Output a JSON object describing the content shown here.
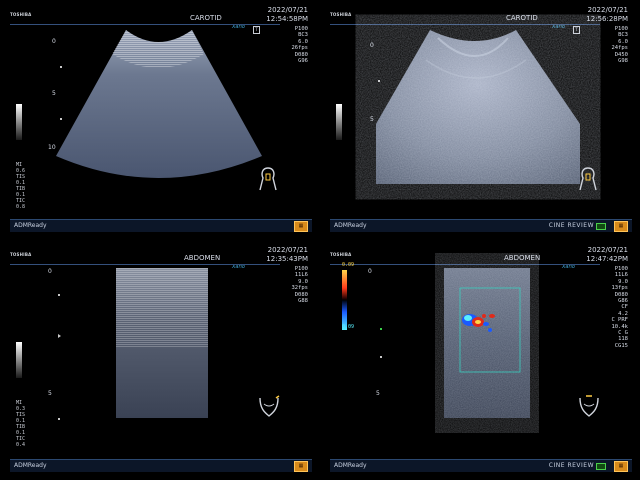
{
  "brand": "TOSHIBA",
  "logo": "Xario",
  "panels": [
    {
      "preset": "CAROTID",
      "date": "2022/07/21",
      "time": "12:54:58PM",
      "params": [
        "P100",
        "BC3",
        "6.0",
        "26fps",
        "D080",
        "G96"
      ],
      "depths": [
        "0",
        "5",
        "10"
      ],
      "mi": [
        "MI",
        "0.6",
        "TIS",
        "0.1",
        "TIB",
        "0.1",
        "TIC",
        "0.8"
      ],
      "status": "ADMReady",
      "cine": "",
      "colorscale": []
    },
    {
      "preset": "CAROTID",
      "date": "2022/07/21",
      "time": "12:56:28PM",
      "params": [
        "P100",
        "BC3",
        "6.0",
        "24fps",
        "D450",
        "G98"
      ],
      "depths": [
        "0",
        "5"
      ],
      "mi": [],
      "status": "ADMReady",
      "cine": "CINE REVIEW",
      "colorscale": []
    },
    {
      "preset": "ABDOMEN",
      "date": "2022/07/21",
      "time": "12:35:43PM",
      "params": [
        "P100",
        "11L6",
        "9.0",
        "32fps",
        "D080",
        "G88"
      ],
      "depths": [
        "0",
        "5"
      ],
      "mi": [
        "MI",
        "0.3",
        "TIS",
        "0.1",
        "TIB",
        "0.1",
        "TIC",
        "0.4"
      ],
      "status": "ADMReady",
      "cine": "",
      "colorscale": []
    },
    {
      "preset": "ABDOMEN",
      "date": "2022/07/21",
      "time": "12:47:42PM",
      "params": [
        "P100",
        "11L6",
        "9.0",
        "13fps",
        "D080",
        "G86",
        "CF",
        "4.2",
        "C PRF",
        "10.4k",
        "C G",
        "118",
        "CG15"
      ],
      "depths": [
        "0",
        "5"
      ],
      "mi": [],
      "status": "ADMReady",
      "cine": "CINE REVIEW",
      "colorscale": [
        "0.09",
        "0.09"
      ]
    }
  ],
  "colors": {
    "header_line": "#34507c",
    "footer_bg": "#0c1628",
    "store_icon": "#d88a1a",
    "cine_box": "#4bd04b",
    "logo": "#3fa7d6"
  }
}
